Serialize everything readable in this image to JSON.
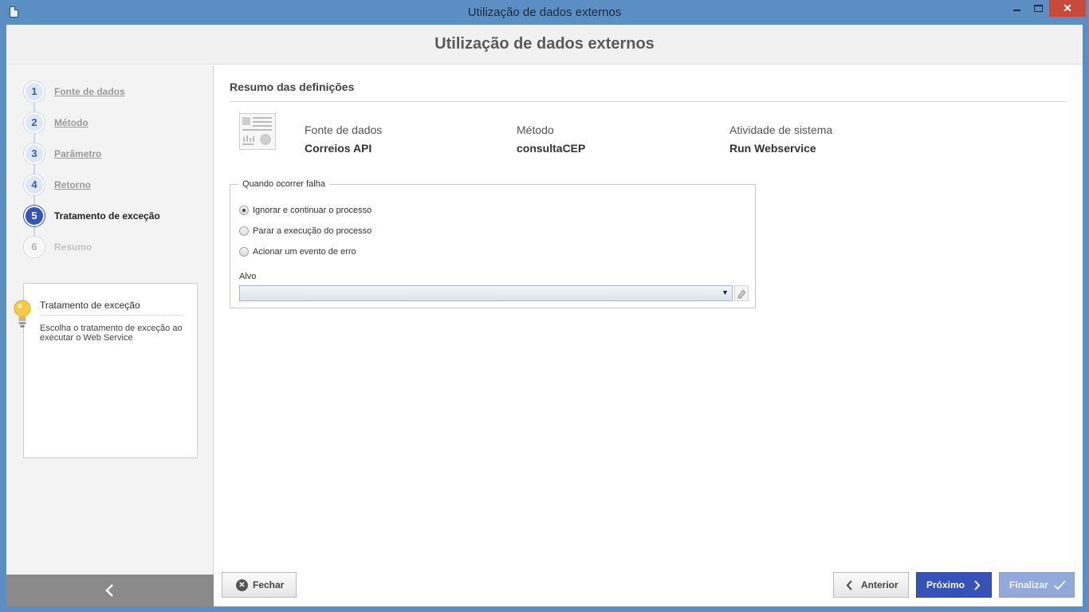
{
  "window": {
    "title": "Utilização de dados externos",
    "minimize_glyph": "",
    "maximize_glyph": "",
    "close_glyph": "✕"
  },
  "header": {
    "title": "Utilização de dados externos"
  },
  "steps": [
    {
      "num": "1",
      "label": "Fonte de dados",
      "state": "done"
    },
    {
      "num": "2",
      "label": "Método",
      "state": "done"
    },
    {
      "num": "3",
      "label": "Parâmetro",
      "state": "done"
    },
    {
      "num": "4",
      "label": "Retorno",
      "state": "done"
    },
    {
      "num": "5",
      "label": "Tratamento de exceção",
      "state": "active"
    },
    {
      "num": "6",
      "label": "Resumo",
      "state": "disabled"
    }
  ],
  "help": {
    "title": "Tratamento de exceção",
    "text": "Escolha o tratamento de exceção ao executar o Web Service",
    "icon": "lightbulb-icon"
  },
  "summary": {
    "title": "Resumo das definições",
    "items": [
      {
        "key": "Fonte de dados",
        "value": "Correios API"
      },
      {
        "key": "Método",
        "value": "consultaCEP"
      },
      {
        "key": "Atividade de sistema",
        "value": "Run Webservice"
      }
    ]
  },
  "failure": {
    "legend": "Quando ocorrer falha",
    "options": [
      {
        "label": "Ignorar e continuar o processo",
        "checked": true
      },
      {
        "label": "Parar a execução do processo",
        "checked": false
      },
      {
        "label": "Acionar um evento de erro",
        "checked": false
      }
    ],
    "target_label": "Alvo",
    "target_value": "",
    "dropdown_arrow": "▼"
  },
  "footer": {
    "close": "Fechar",
    "close_glyph": "✕",
    "previous": "Anterior",
    "next": "Próximo",
    "finish": "Finalizar"
  },
  "colors": {
    "accent": "#3452b8",
    "accent_disabled": "#93a9d9",
    "window_frame": "#5b8fc4",
    "close_button": "#c74a3a"
  }
}
